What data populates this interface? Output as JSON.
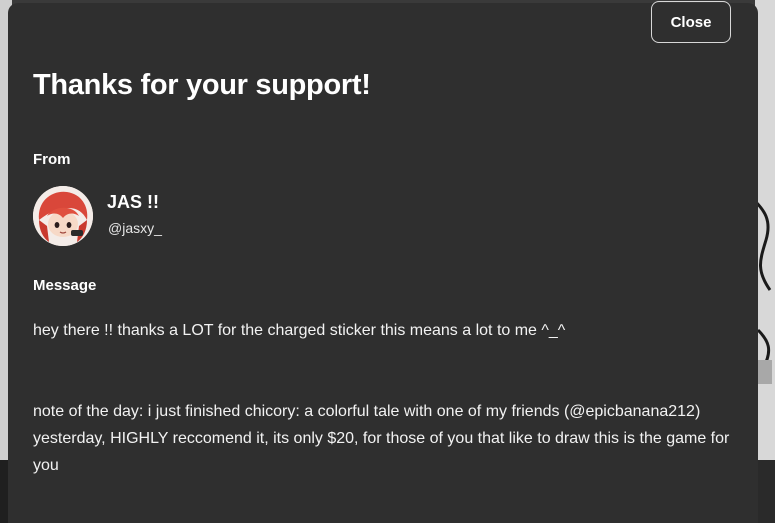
{
  "modal": {
    "close_label": "Close",
    "title": "Thanks for your support!",
    "from_label": "From",
    "message_label": "Message"
  },
  "sender": {
    "name": "JAS !!",
    "handle": "@jasxy_"
  },
  "message": {
    "paragraphs": [
      "hey there !! thanks a LOT for the charged sticker this means a lot to me ^_^",
      "note of the day: i just finished chicory: a colorful tale with one of my friends (@epicbanana212) yesterday, HIGHLY reccomend it, its only $20, for those of you that like to draw this is the game for you"
    ]
  },
  "colors": {
    "modal_background": "#2f2f2f",
    "text": "#ffffff",
    "close_border": "#d8d8d8"
  }
}
